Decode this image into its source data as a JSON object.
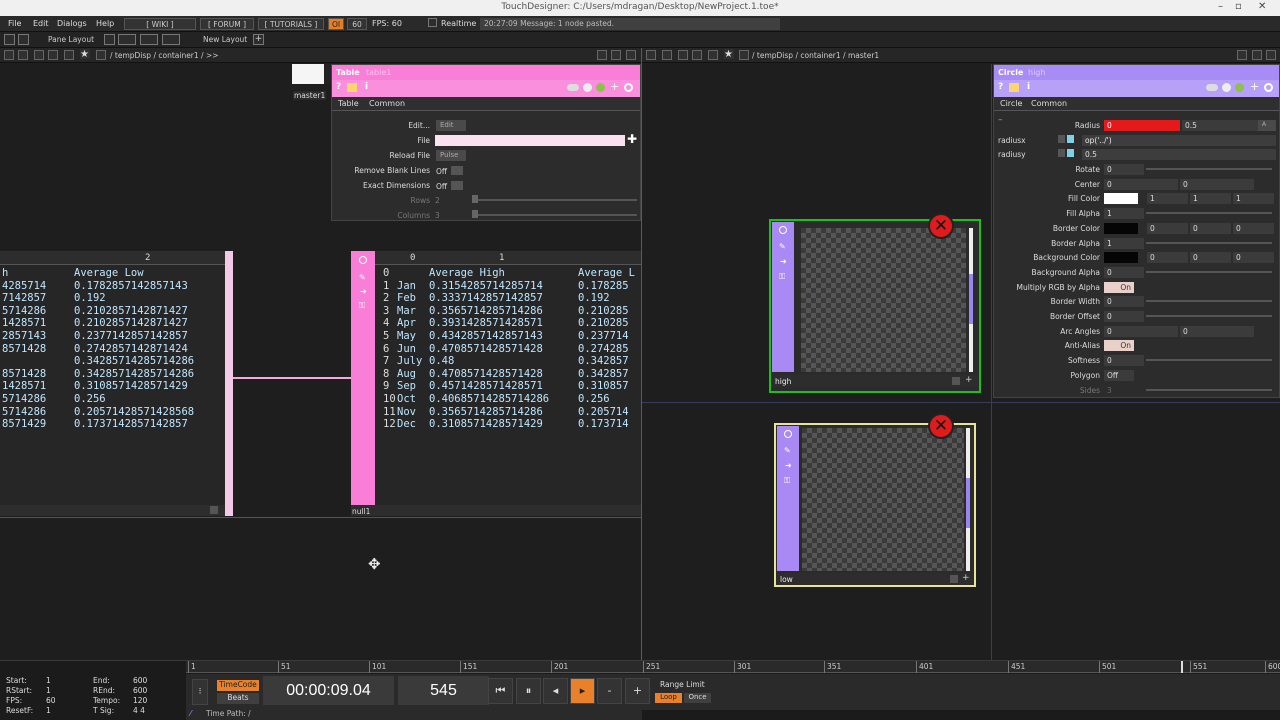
{
  "window": {
    "title": "TouchDesigner: C:/Users/mdragan/Desktop/NewProject.1.toe*",
    "min": "–",
    "max": "▫",
    "close": "✕"
  },
  "menubar": {
    "items": [
      "File",
      "Edit",
      "Dialogs",
      "Help"
    ],
    "buttons": [
      "[ WIKI ]",
      "[ FORUM ]",
      "[ TUTORIALS ]"
    ],
    "oi": "OI",
    "fps_setting": "60",
    "fps_label": "FPS: 60",
    "realtime": "Realtime",
    "status": "20:27:09 Message: 1 node pasted."
  },
  "panebar": {
    "pane_layout": "Pane Layout",
    "new_layout": "New Layout",
    "plus": "+"
  },
  "left_pane": {
    "path": "/ tempDisp / container1 / >>",
    "master_label": "master1",
    "param": {
      "type": "Table",
      "name": "table1",
      "tabs": [
        "Table",
        "Common"
      ],
      "rows": [
        {
          "label": "Edit...",
          "value": "Edit"
        },
        {
          "label": "File",
          "value": ""
        },
        {
          "label": "Reload File",
          "value": "Pulse"
        },
        {
          "label": "Remove Blank Lines",
          "value": "Off"
        },
        {
          "label": "Exact Dimensions",
          "value": "Off"
        },
        {
          "label": "Rows",
          "value": "2"
        },
        {
          "label": "Columns",
          "value": "3"
        }
      ]
    },
    "table_left": {
      "col_header": "2",
      "header_row": [
        "h",
        "Average Low"
      ],
      "rows": [
        [
          "4285714",
          "0.1782857142857143"
        ],
        [
          "7142857",
          "0.192"
        ],
        [
          "5714286",
          "0.2102857142871427"
        ],
        [
          "1428571",
          "0.2102857142871427"
        ],
        [
          "2857143",
          "0.2377142857142857"
        ],
        [
          "8571428",
          "0.2742857142871424"
        ],
        [
          "",
          "0.3428571428571428​6"
        ],
        [
          "8571428",
          "0.3428571428571428​6"
        ],
        [
          "1428571",
          "0.3108571428571429"
        ],
        [
          "5714286",
          "0.256"
        ],
        [
          "5714286",
          "0.2057142857142856​8"
        ],
        [
          "8571429",
          "0.1737142857142857"
        ]
      ]
    },
    "table_right": {
      "col_headers": [
        "0",
        "1"
      ],
      "label": "null1",
      "header": [
        "0",
        "Average High",
        "Average L"
      ],
      "rows": [
        [
          "1",
          "Jan",
          "0.3154285714285714",
          "0.178285"
        ],
        [
          "2",
          "Feb",
          "0.3337142857142857",
          "0.192"
        ],
        [
          "3",
          "Mar",
          "0.3565714285714286",
          "0.210285"
        ],
        [
          "4",
          "Apr",
          "0.3931428571428571",
          "0.210285"
        ],
        [
          "5",
          "May",
          "0.4342857142857143",
          "0.237714"
        ],
        [
          "6",
          "Jun",
          "0.4708571428571428",
          "0.274285"
        ],
        [
          "7",
          "July",
          "0.48",
          "0.342857"
        ],
        [
          "8",
          "Aug",
          "0.4708571428571428",
          "0.342857"
        ],
        [
          "9",
          "Sep",
          "0.4571428571428571",
          "0.310857"
        ],
        [
          "10",
          "Oct",
          "0.4068571428571428​6",
          "0.256"
        ],
        [
          "11",
          "Nov",
          "0.3565714285714286",
          "0.205714"
        ],
        [
          "12",
          "Dec",
          "0.3108571428571429",
          "0.173714"
        ]
      ]
    }
  },
  "right_pane": {
    "path": "/ tempDisp / container1 / master1",
    "param": {
      "type": "Circle",
      "name": "high",
      "tabs": [
        "Circle",
        "Common"
      ],
      "radius_label": "Radius",
      "radius_x": "0",
      "radius_y": "0.5",
      "radiusx_label": "radiusx",
      "radiusx_expr": "op('../')",
      "radiusy_label": "radiusy",
      "radiusy_val": "0.5",
      "rows": [
        {
          "label": "Rotate",
          "v": [
            "0"
          ]
        },
        {
          "label": "Center",
          "v": [
            "0",
            "0"
          ]
        },
        {
          "label": "Fill Color",
          "v": [
            "",
            "1",
            "1",
            "1"
          ]
        },
        {
          "label": "Fill Alpha",
          "v": [
            "1"
          ]
        },
        {
          "label": "Border Color",
          "v": [
            "",
            "0",
            "0",
            "0"
          ]
        },
        {
          "label": "Border Alpha",
          "v": [
            "1"
          ]
        },
        {
          "label": "Background Color",
          "v": [
            "",
            "0",
            "0",
            "0"
          ]
        },
        {
          "label": "Background Alpha",
          "v": [
            "0"
          ]
        },
        {
          "label": "Multiply RGB by Alpha",
          "v": [
            "On"
          ]
        },
        {
          "label": "Border Width",
          "v": [
            "0"
          ]
        },
        {
          "label": "Border Offset",
          "v": [
            "0"
          ]
        },
        {
          "label": "Arc Angles",
          "v": [
            "0",
            "0"
          ]
        },
        {
          "label": "Anti-Alias",
          "v": [
            "On"
          ]
        },
        {
          "label": "Softness",
          "v": [
            "0"
          ]
        },
        {
          "label": "Polygon",
          "v": [
            "Off"
          ]
        },
        {
          "label": "Sides",
          "v": [
            "3"
          ]
        }
      ]
    },
    "nodes": [
      {
        "label": "high",
        "error": "✕"
      },
      {
        "label": "low",
        "error": "✕"
      }
    ]
  },
  "timeline": {
    "ticks": [
      "1",
      "51",
      "101",
      "151",
      "201",
      "251",
      "301",
      "351",
      "401",
      "451",
      "501",
      "551",
      "600"
    ],
    "start": "Start:",
    "start_v": "1",
    "rstart": "RStart:",
    "rstart_v": "1",
    "fps": "FPS:",
    "fps_v": "60",
    "resetf": "ResetF:",
    "resetf_v": "1",
    "end": "End:",
    "end_v": "600",
    "rend": "REnd:",
    "rend_v": "600",
    "tempo": "Tempo:",
    "tempo_v": "120",
    "tsig": "T Sig:",
    "tsig_v": "4     4",
    "timecode_btn": "TimeCode",
    "beats_btn": "Beats",
    "timecode": "00:00:09.04",
    "frame": "545",
    "range_limit": "Range Limit",
    "loop": "Loop",
    "once": "Once",
    "time_path": "Time Path: /"
  }
}
